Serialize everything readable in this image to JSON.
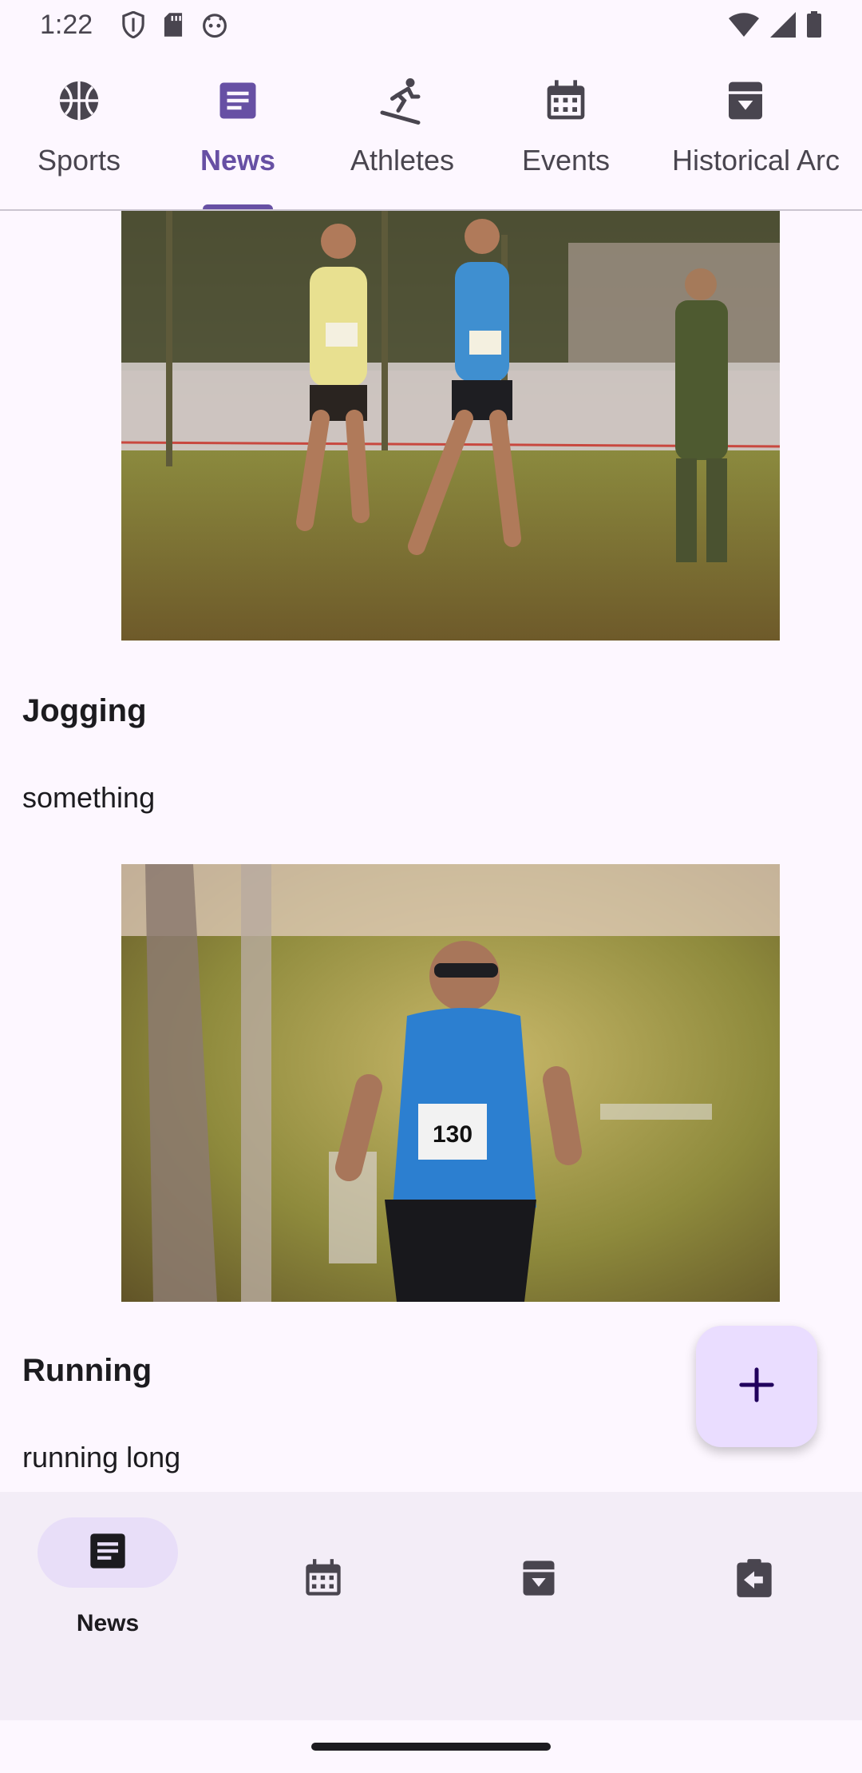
{
  "status_bar": {
    "time": "1:22"
  },
  "tabs": [
    {
      "label": "Sports",
      "icon": "basketball-icon",
      "active": false
    },
    {
      "label": "News",
      "icon": "article-icon",
      "active": true
    },
    {
      "label": "Athletes",
      "icon": "skiing-icon",
      "active": false
    },
    {
      "label": "Events",
      "icon": "calendar-icon",
      "active": false
    },
    {
      "label": "Historical Arc",
      "icon": "archive-icon",
      "active": false
    }
  ],
  "news": [
    {
      "title": "Jogging",
      "description": "something"
    },
    {
      "title": "Running",
      "description": "running long"
    }
  ],
  "fab": {
    "icon": "plus-icon"
  },
  "bottom_nav": [
    {
      "label": "News",
      "icon": "article-icon",
      "active": true
    },
    {
      "label": "",
      "icon": "calendar-icon",
      "active": false
    },
    {
      "label": "",
      "icon": "archive-icon",
      "active": false
    },
    {
      "label": "",
      "icon": "assignment-return-icon",
      "active": false
    }
  ],
  "colors": {
    "accent": "#6750A4",
    "surface": "#FDF7FF",
    "nav_bg": "#F3EDF7",
    "fab_bg": "#EADDFF"
  }
}
